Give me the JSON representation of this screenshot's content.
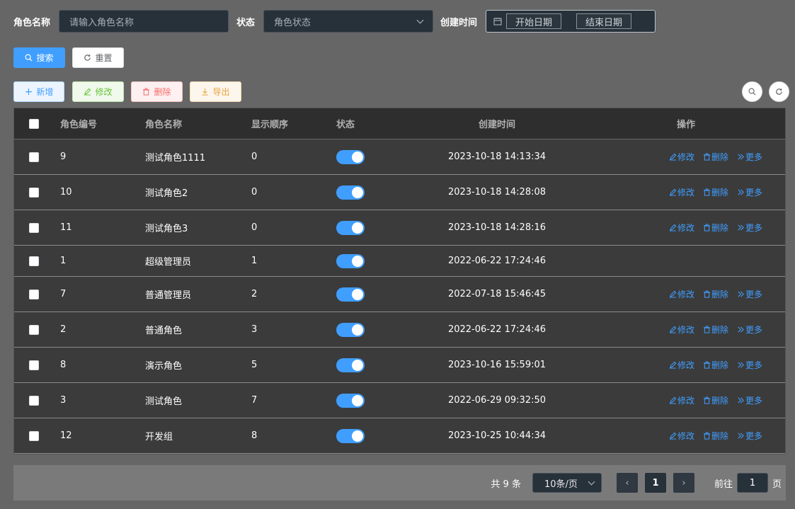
{
  "search_form": {
    "role_name_label": "角色名称",
    "role_name_placeholder": "请输入角色名称",
    "status_label": "状态",
    "status_placeholder": "角色状态",
    "created_label": "创建时间",
    "start_date": "开始日期",
    "end_date": "结束日期",
    "search_button": "搜索",
    "reset_button": "重置"
  },
  "toolbar": {
    "add": "新增",
    "edit": "修改",
    "delete": "删除",
    "export": "导出"
  },
  "table": {
    "headers": {
      "id": "角色编号",
      "name": "角色名称",
      "order": "显示顺序",
      "status": "状态",
      "created": "创建时间",
      "ops": "操作"
    },
    "op_labels": {
      "edit": "修改",
      "delete": "删除",
      "more": "更多"
    },
    "rows": [
      {
        "id": "9",
        "name": "测试角色1111",
        "order": "0",
        "status_on": true,
        "created": "2023-10-18 14:13:34",
        "has_ops": true
      },
      {
        "id": "10",
        "name": "测试角色2",
        "order": "0",
        "status_on": true,
        "created": "2023-10-18 14:28:08",
        "has_ops": true
      },
      {
        "id": "11",
        "name": "测试角色3",
        "order": "0",
        "status_on": true,
        "created": "2023-10-18 14:28:16",
        "has_ops": true
      },
      {
        "id": "1",
        "name": "超级管理员",
        "order": "1",
        "status_on": true,
        "created": "2022-06-22 17:24:46",
        "has_ops": false
      },
      {
        "id": "7",
        "name": "普通管理员",
        "order": "2",
        "status_on": true,
        "created": "2022-07-18 15:46:45",
        "has_ops": true
      },
      {
        "id": "2",
        "name": "普通角色",
        "order": "3",
        "status_on": true,
        "created": "2022-06-22 17:24:46",
        "has_ops": true
      },
      {
        "id": "8",
        "name": "演示角色",
        "order": "5",
        "status_on": true,
        "created": "2023-10-16 15:59:01",
        "has_ops": true
      },
      {
        "id": "3",
        "name": "测试角色",
        "order": "7",
        "status_on": true,
        "created": "2022-06-29 09:32:50",
        "has_ops": true
      },
      {
        "id": "12",
        "name": "开发组",
        "order": "8",
        "status_on": true,
        "created": "2023-10-25 10:44:34",
        "has_ops": true
      }
    ]
  },
  "pagination": {
    "total": "共 9 条",
    "page_size": "10条/页",
    "current_page": "1",
    "goto_prefix": "前往",
    "goto_value": "1",
    "goto_suffix": "页"
  },
  "colors": {
    "primary": "#409eff",
    "success": "#67c23a",
    "danger": "#f56c6c",
    "warning": "#e6a23c"
  },
  "icons": {
    "search": "search-icon",
    "reset": "refresh-icon",
    "add": "plus-icon",
    "edit": "edit-icon",
    "delete": "trash-icon",
    "export": "download-icon",
    "more": "double-chevron-right-icon",
    "calendar": "calendar-icon"
  }
}
